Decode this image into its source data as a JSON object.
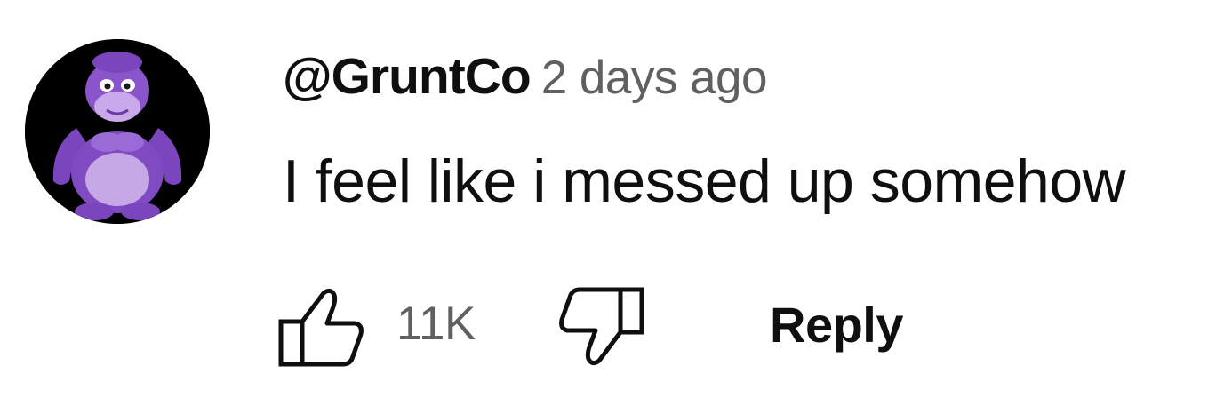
{
  "comment": {
    "author": "@GruntCo",
    "timestamp": "2 days ago",
    "text": "I feel like i messed up somehow",
    "avatar_icon": "purple-gorilla-avatar-icon",
    "actions": {
      "like_icon": "thumbs-up-icon",
      "like_count": "11K",
      "dislike_icon": "thumbs-down-icon",
      "reply_label": "Reply"
    }
  },
  "colors": {
    "primary_text": "#0f0f0f",
    "secondary_text": "#606060",
    "avatar_background": "#000000",
    "avatar_purple": "#8f5cc9"
  }
}
